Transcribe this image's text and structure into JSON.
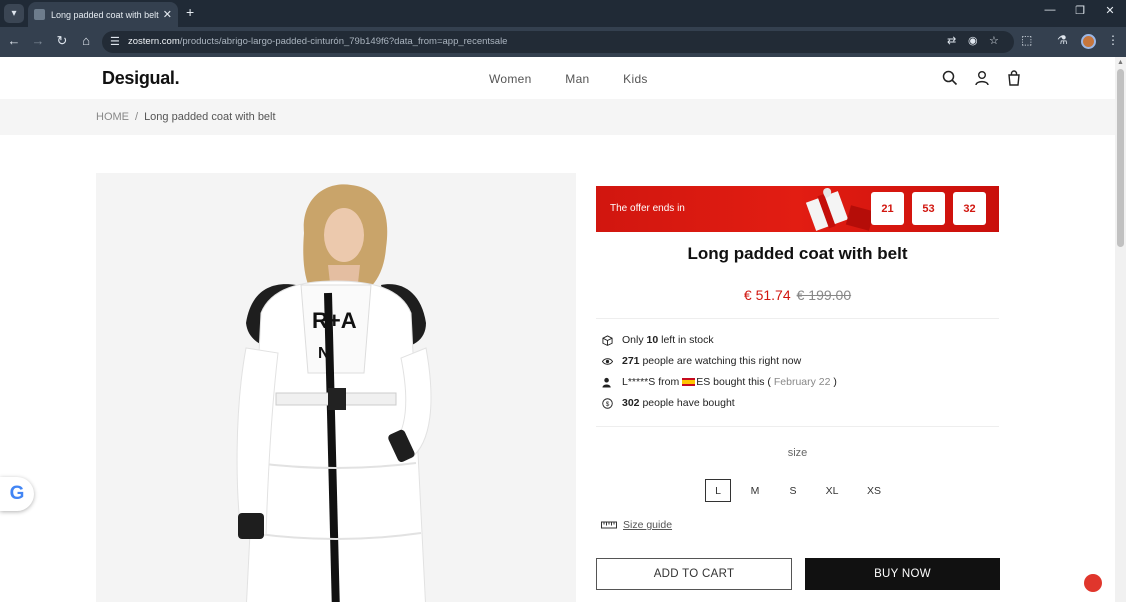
{
  "browser": {
    "tab_title": "Long padded coat with belt - D",
    "url_domain": "zostern.com",
    "url_path": "/products/abrigo-largo-padded-cinturón_79b149f6?data_from=app_recentsale"
  },
  "site": {
    "logo": "Desigual.",
    "nav": [
      "Women",
      "Man",
      "Kids"
    ]
  },
  "breadcrumb": {
    "home": "HOME",
    "separator": "/",
    "current": "Long padded coat with belt"
  },
  "offer": {
    "text": "The offer ends in",
    "countdown": [
      "21",
      "53",
      "32"
    ]
  },
  "product": {
    "title": "Long padded coat with belt",
    "price_sale": "€ 51.74",
    "price_old": "€ 199.00"
  },
  "info": {
    "stock_pre": "Only",
    "stock_num": "10",
    "stock_post": "left in stock",
    "watching_num": "271",
    "watching_text": "people are watching this right now",
    "bought_user": "L*****S",
    "bought_from": "from",
    "bought_country": "ES",
    "bought_text": "bought this (",
    "bought_date": "February 22",
    "bought_close": ")",
    "total_num": "302",
    "total_text": "people have bought"
  },
  "size": {
    "label": "size",
    "options": [
      "L",
      "M",
      "S",
      "XL",
      "XS"
    ],
    "selected": "L",
    "guide": "Size guide"
  },
  "actions": {
    "add_to_cart": "ADD TO CART",
    "buy_now": "BUY NOW"
  },
  "widgets": {
    "google_letter": "G"
  },
  "colors": {
    "accent_red": "#d1160f",
    "chrome_dark": "#202a36",
    "button_dark": "#111111"
  }
}
